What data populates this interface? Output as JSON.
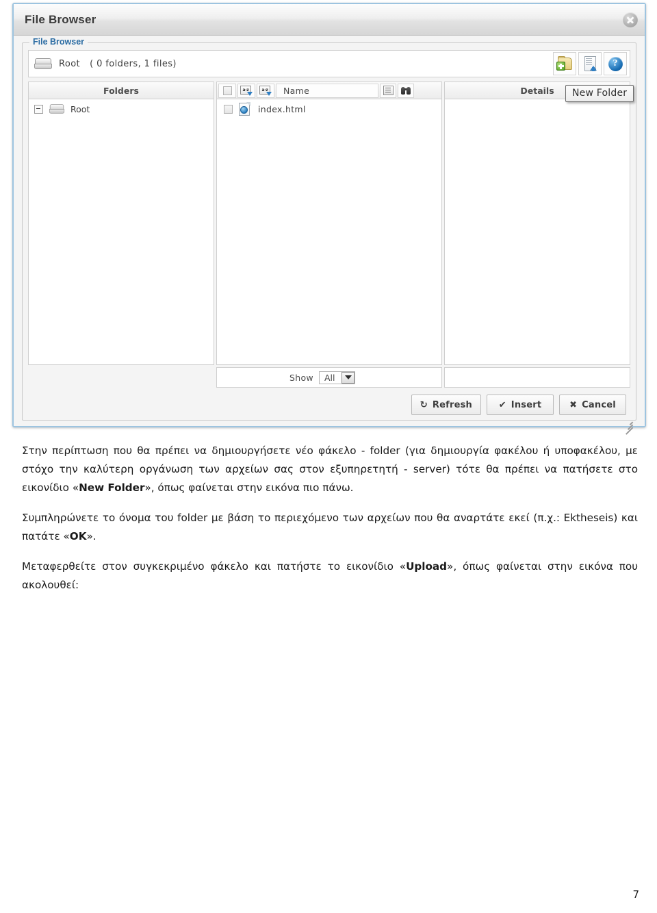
{
  "window": {
    "title": "File Browser",
    "close_icon": "close-icon",
    "legend": "File Browser"
  },
  "pathbar": {
    "drive_icon": "drive-icon",
    "name": "Root",
    "count": "( 0 folders, 1 files)",
    "tools": [
      {
        "icon": "new-folder-icon",
        "label": "New Folder"
      },
      {
        "icon": "upload-icon",
        "label": "Upload"
      },
      {
        "icon": "help-icon",
        "label": "?"
      }
    ]
  },
  "tooltip": {
    "text": "New Folder"
  },
  "panels": {
    "folders": {
      "header": "Folders",
      "tree": [
        {
          "label": "Root",
          "expander": "collapse-icon",
          "icon": "drive-icon"
        }
      ]
    },
    "files": {
      "header_name": "Name",
      "header_icons": [
        "sort-az-icon",
        "sort-az-icon",
        "list-view-icon",
        "search-binoculars-icon"
      ],
      "rows": [
        {
          "name": "index.html",
          "icon": "html-file-icon"
        }
      ]
    },
    "details": {
      "header": "Details"
    }
  },
  "showbar": {
    "label": "Show",
    "value": "All",
    "options": [
      "All"
    ]
  },
  "footer": {
    "buttons": [
      {
        "label": "Refresh",
        "glyph": "↻",
        "icon": "refresh-icon"
      },
      {
        "label": "Insert",
        "glyph": "✔",
        "icon": "check-icon"
      },
      {
        "label": "Cancel",
        "glyph": "✖",
        "icon": "x-icon"
      }
    ]
  },
  "document": {
    "paragraph_1_a": "Στην περίπτωση που θα πρέπει να δημιουργήσετε νέο φάκελο - folder (για δημιουργία φακέλου ή υποφακέλου, με στόχο την καλύτερη οργάνωση των αρχείων σας στον εξυπηρετητή - server) τότε θα πρέπει να πατήσετε στο εικονίδιο «",
    "paragraph_1_bold": "New Folder",
    "paragraph_1_b": "», όπως φαίνεται στην εικόνα πιο πάνω.",
    "paragraph_2_a": "Συμπληρώνετε το όνομα του folder με βάση το περιεχόμενο των αρχείων που θα αναρτάτε εκεί (π.χ.: Ektheseis) και πατάτε «",
    "paragraph_2_bold": "OK",
    "paragraph_2_b": "».",
    "paragraph_3_a": "Μεταφερθείτε στον συγκεκριμένο φάκελο και πατήστε το εικονίδιο «",
    "paragraph_3_bold": "Upload",
    "paragraph_3_b": "»,  όπως φαίνεται στην εικόνα που ακολουθεί:",
    "page_number": "7"
  },
  "colors": {
    "window_border": "#9dc4e0",
    "legend_text": "#2b6ca3",
    "accent_blue": "#2f7fc4",
    "plus_green": "#4f9c1e"
  }
}
